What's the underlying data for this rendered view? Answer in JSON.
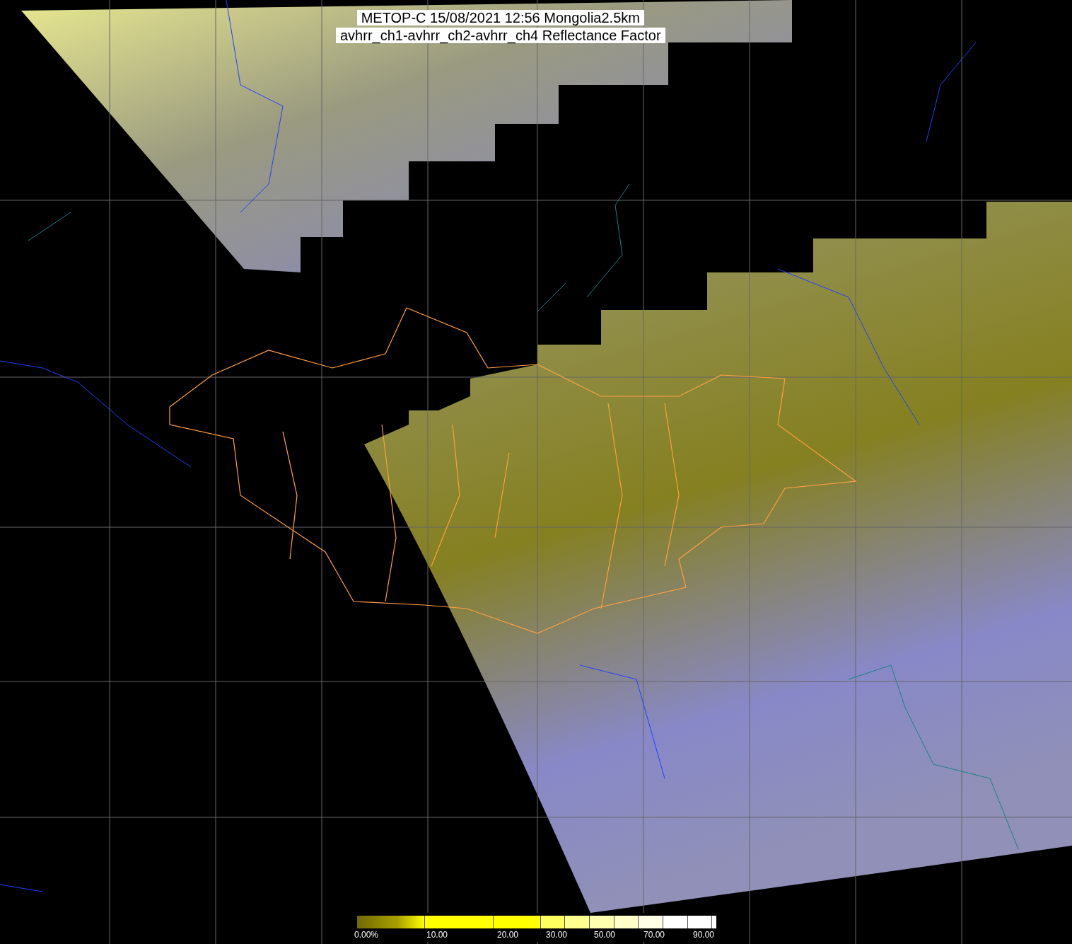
{
  "title": {
    "lines": [
      "METOP-C 15/08/2021 12:56 Mongolia2.5km",
      "avhrr_ch1-avhrr_ch2-avhrr_ch4 Reflectance Factor"
    ]
  },
  "colorbar": {
    "segments": [
      {
        "color": "#a8a000"
      },
      {
        "color": "#ffff00"
      },
      {
        "color": "#ffff00"
      },
      {
        "color": "#ffff60"
      },
      {
        "color": "#ffff90"
      },
      {
        "color": "#ffffb0"
      },
      {
        "color": "#ffffc8"
      },
      {
        "color": "#ffffe8"
      },
      {
        "color": "#ffffff"
      },
      {
        "color": "#ffffff"
      },
      {
        "color": "#ffffff"
      }
    ],
    "labels": [
      "0.00%",
      "10.00",
      "20.00",
      "30.00",
      "50.00",
      "70.00",
      "90.00"
    ]
  }
}
